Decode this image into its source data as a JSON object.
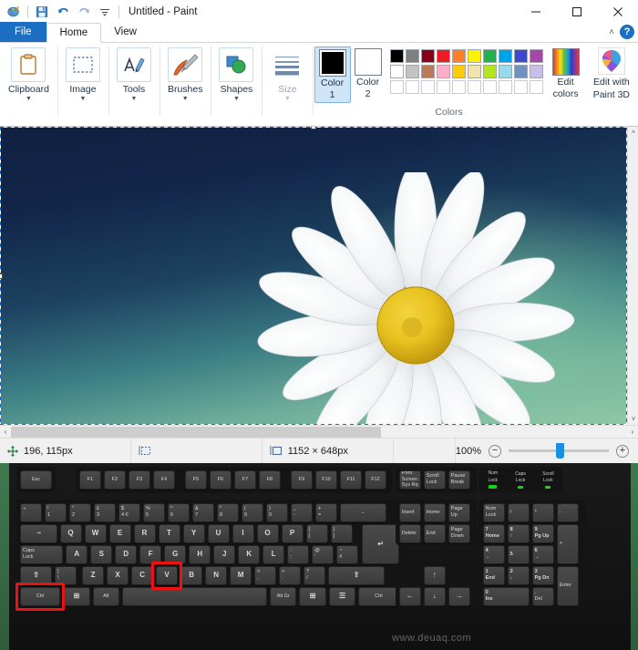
{
  "window": {
    "title": "Untitled - Paint",
    "quick_access": [
      {
        "name": "paint-logo-icon",
        "label": "Paint"
      },
      {
        "name": "save-icon",
        "label": "Save"
      },
      {
        "name": "undo-icon",
        "label": "Undo"
      },
      {
        "name": "redo-icon",
        "label": "Redo"
      },
      {
        "name": "customize-qat-icon",
        "label": "Customize Quick Access Toolbar"
      }
    ],
    "controls": [
      {
        "name": "minimize-button",
        "label": "Minimize"
      },
      {
        "name": "maximize-button",
        "label": "Maximize"
      },
      {
        "name": "close-button",
        "label": "Close"
      }
    ]
  },
  "tabs": [
    {
      "label": "File",
      "kind": "file"
    },
    {
      "label": "Home",
      "kind": "active"
    },
    {
      "label": "View",
      "kind": "normal"
    }
  ],
  "ribbon": {
    "collapse_label": "˄",
    "help_label": "?",
    "groups": [
      {
        "label": "Clipboard",
        "icon": "clipboard-icon",
        "dimmed": false
      },
      {
        "label": "Image",
        "icon": "select-rectangle-icon",
        "dimmed": false
      },
      {
        "label": "Tools",
        "icon": "pencil-tools-icon",
        "dimmed": false
      },
      {
        "label": "Brushes",
        "icon": "brush-icon",
        "dimmed": false
      },
      {
        "label": "Shapes",
        "icon": "shapes-icon",
        "dimmed": false
      },
      {
        "label": "Size",
        "icon": "line-size-icon",
        "dimmed": true
      }
    ],
    "colors": {
      "group_title": "Colors",
      "color1_label": "Color\n1",
      "color1_line1": "Color",
      "color1_line2": "1",
      "color1_value": "#000000",
      "color2_line1": "Color",
      "color2_line2": "2",
      "color2_value": "#ffffff",
      "row1": [
        "#000000",
        "#7f7f7f",
        "#880015",
        "#ed1c24",
        "#ff7f27",
        "#fff200",
        "#22b14c",
        "#00a2e8",
        "#3f48cc",
        "#a349a4"
      ],
      "row2": [
        "#ffffff",
        "#c3c3c3",
        "#b97a57",
        "#ffaec9",
        "#ffc90e",
        "#efe4b0",
        "#b5e61d",
        "#99d9ea",
        "#7092be",
        "#c8bfe7"
      ],
      "row3": [
        "",
        "",
        "",
        "",
        "",
        "",
        "",
        "",
        "",
        ""
      ],
      "edit_colors_line1": "Edit",
      "edit_colors_line2": "colors",
      "paint3d_line1": "Edit with",
      "paint3d_line2": "Paint 3D"
    }
  },
  "canvas": {
    "content": "white-daisy-flower-on-blue-green-gradient",
    "selection_active": true
  },
  "statusbar": {
    "cursor_position": "196, 115px",
    "cursor_icon": "crosshair-position-icon",
    "selection_size": "",
    "selection_icon": "selection-size-icon",
    "image_size": "1152 × 648px",
    "image_size_icon": "image-dimensions-icon",
    "zoom_level": "100%",
    "zoom_out_label": "−",
    "zoom_in_label": "+"
  },
  "keyboard": {
    "layout": "UK",
    "watermark": "www.deuaq.com",
    "highlighted_keys": [
      "Ctrl",
      "V"
    ],
    "highlight_color": "#ee1111",
    "leds": [
      {
        "label_line1": "Num",
        "label_line2": "Lock",
        "on": true
      },
      {
        "label_line1": "Caps",
        "label_line2": "Lock",
        "on": true
      },
      {
        "label_line1": "Scroll",
        "label_line2": "Lock",
        "on": true
      }
    ],
    "function_row": [
      "Esc",
      "F1",
      "F2",
      "F3",
      "F4",
      "F5",
      "F6",
      "F7",
      "F8",
      "F9",
      "F10",
      "F11",
      "F12"
    ],
    "nav_top": [
      {
        "line1": "Print",
        "line2": "Screen",
        "line3": "Sys Rq"
      },
      {
        "line1": "Scroll",
        "line2": "Lock",
        "line3": ""
      },
      {
        "line1": "Pause",
        "line2": "Break",
        "line3": ""
      }
    ],
    "number_row": [
      {
        "top": "¬",
        "bottom": "`"
      },
      {
        "top": "!",
        "bottom": "1"
      },
      {
        "top": "\"",
        "bottom": "2"
      },
      {
        "top": "£",
        "bottom": "3"
      },
      {
        "top": "$",
        "bottom": "4 €"
      },
      {
        "top": "%",
        "bottom": "5"
      },
      {
        "top": "^",
        "bottom": "6"
      },
      {
        "top": "&",
        "bottom": "7"
      },
      {
        "top": "*",
        "bottom": "8"
      },
      {
        "top": "(",
        "bottom": "9"
      },
      {
        "top": ")",
        "bottom": "0"
      },
      {
        "top": "_",
        "bottom": "-"
      },
      {
        "top": "+",
        "bottom": "="
      }
    ],
    "backspace": "←",
    "tab_key": "⇥",
    "qwerty_row": [
      "Q",
      "W",
      "E",
      "R",
      "T",
      "Y",
      "U",
      "I",
      "O",
      "P"
    ],
    "qwerty_extra": [
      {
        "top": "{",
        "bottom": "["
      },
      {
        "top": "}",
        "bottom": "]"
      }
    ],
    "enter_key": "↵",
    "caps_lock": {
      "line1": "Caps",
      "line2": "Lock"
    },
    "asdf_row": [
      "A",
      "S",
      "D",
      "F",
      "G",
      "H",
      "J",
      "K",
      "L"
    ],
    "asdf_extra": [
      {
        "top": ":",
        "bottom": ";"
      },
      {
        "top": "@",
        "bottom": "'"
      },
      {
        "top": "~",
        "bottom": "#"
      }
    ],
    "shift_key": "⇧",
    "backslash": {
      "top": "|",
      "bottom": "\\"
    },
    "zxcv_row": [
      "Z",
      "X",
      "C",
      "V",
      "B",
      "N",
      "M"
    ],
    "zxcv_extra": [
      {
        "top": "<",
        "bottom": ","
      },
      {
        "top": ">",
        "bottom": "."
      },
      {
        "top": "?",
        "bottom": "/"
      }
    ],
    "bottom_row": [
      "Ctrl",
      "⊞",
      "Alt",
      "",
      "Alt Gr",
      "⊞",
      "☰",
      "Ctrl"
    ],
    "nav_cluster": [
      "Insert",
      "Home",
      "Page Up",
      "Delete",
      "End",
      "Page Down"
    ],
    "arrows": [
      "↑",
      "←",
      "↓",
      "→"
    ],
    "numpad": [
      {
        "line1": "Num",
        "line2": "Lock"
      },
      {
        "line1": "/",
        "line2": ""
      },
      {
        "line1": "*",
        "line2": ""
      },
      {
        "line1": "-",
        "line2": ""
      },
      {
        "line1": "7",
        "line2": "Home"
      },
      {
        "line1": "8",
        "line2": "↑"
      },
      {
        "line1": "9",
        "line2": "Pg Up"
      },
      {
        "line1": "+",
        "line2": ""
      },
      {
        "line1": "4",
        "line2": "←"
      },
      {
        "line1": "5",
        "line2": ""
      },
      {
        "line1": "6",
        "line2": "→"
      },
      {
        "line1": "1",
        "line2": "End"
      },
      {
        "line1": "2",
        "line2": "↓"
      },
      {
        "line1": "3",
        "line2": "Pg Dn"
      },
      {
        "line1": "Enter",
        "line2": ""
      },
      {
        "line1": "0",
        "line2": "Ins"
      },
      {
        "line1": ".",
        "line2": "Del"
      }
    ]
  }
}
